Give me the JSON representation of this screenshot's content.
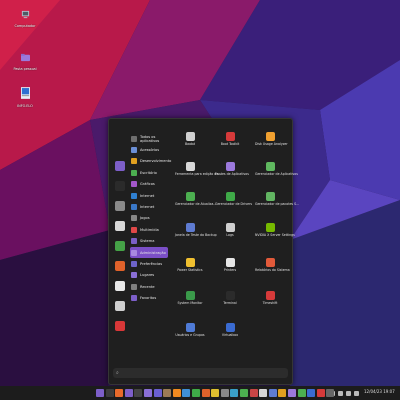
{
  "desktop": {
    "icons": [
      {
        "label": "Computador",
        "icon": "computer-icon"
      },
      {
        "label": "Pasta pessoal",
        "icon": "home-folder-icon"
      },
      {
        "label": "INFO.ELO",
        "icon": "document-icon"
      }
    ]
  },
  "menu": {
    "favorites": [
      {
        "icon": "file-manager-icon",
        "color": "#7d5fc9"
      },
      {
        "icon": "terminal-icon",
        "color": "#2b2b2b"
      },
      {
        "icon": "settings-icon",
        "color": "#8a8a8a"
      },
      {
        "icon": "calendar-icon",
        "color": "#d9d9d9"
      },
      {
        "icon": "green-app-icon",
        "color": "#45a347"
      },
      {
        "icon": "software-icon",
        "color": "#e0622b"
      },
      {
        "icon": "lock-icon",
        "color": "#e8e8e8"
      },
      {
        "icon": "logout-icon",
        "color": "#cfcfcf"
      },
      {
        "icon": "power-icon",
        "color": "#d93838"
      }
    ],
    "categories": [
      {
        "label": "Todos os aplicativos",
        "icon": "grid-icon",
        "color": "#6f6f6f"
      },
      {
        "label": "Acessórios",
        "icon": "accessories-icon",
        "color": "#6b8fd6"
      },
      {
        "label": "Desenvolvimento",
        "icon": "development-icon",
        "color": "#e0a020"
      },
      {
        "label": "Escritório",
        "icon": "office-icon",
        "color": "#4caf50"
      },
      {
        "label": "Gráficos",
        "icon": "graphics-icon",
        "color": "#a357c9"
      },
      {
        "label": "Internet",
        "icon": "internet-icon",
        "color": "#2f80d1"
      },
      {
        "label": "Internet",
        "icon": "internet-icon",
        "color": "#3a78c8"
      },
      {
        "label": "Jogos",
        "icon": "games-icon",
        "color": "#888888"
      },
      {
        "label": "Multimídia",
        "icon": "multimedia-icon",
        "color": "#e04848"
      },
      {
        "label": "Sistema",
        "icon": "system-icon",
        "color": "#7a5fc7"
      },
      {
        "label": "Administração",
        "icon": "administration-icon",
        "color": "#a889e0"
      },
      {
        "label": "Preferências",
        "icon": "preferences-icon",
        "color": "#6e64c9"
      },
      {
        "label": "Lugares",
        "icon": "places-icon",
        "color": "#8a6fd6"
      },
      {
        "label": "Recente",
        "icon": "recent-icon",
        "color": "#7f7f7f"
      },
      {
        "label": "Favoritos",
        "icon": "favorites-icon",
        "color": "#7d5fc9"
      }
    ],
    "selected_category": "Administração",
    "apps": [
      {
        "label": "Baobá",
        "icon": "disk-usage-icon",
        "color": "#d0d0d0"
      },
      {
        "label": "Boot Toolkit",
        "icon": "boot-toolkit-icon",
        "color": "#d63a3a"
      },
      {
        "label": "Disk Usage Analyzer",
        "icon": "disk-usage-analyzer-icon",
        "color": "#f0a030"
      },
      {
        "label": "Ferramenta para edição de...",
        "icon": "editor-tool-icon",
        "color": "#d8d8d8"
      },
      {
        "label": "Fontes de Aplicativos",
        "icon": "sources-icon",
        "color": "#9b79dc"
      },
      {
        "label": "Gerenciador de Aplicativos",
        "icon": "app-manager-icon",
        "color": "#5fb85f"
      },
      {
        "label": "Gerenciador de Atualiza...",
        "icon": "update-manager-icon",
        "color": "#4caf50"
      },
      {
        "label": "Gerenciador de Drivers",
        "icon": "driver-manager-icon",
        "color": "#3faa48"
      },
      {
        "label": "Gerenciador de pacotes S...",
        "icon": "package-manager-icon",
        "color": "#62b562"
      },
      {
        "label": "Janela de Teste da Backup",
        "icon": "backup-icon",
        "color": "#5e7bd1"
      },
      {
        "label": "Logs",
        "icon": "logs-icon",
        "color": "#cfcfcf"
      },
      {
        "label": "NVIDIA X Server Settings",
        "icon": "nvidia-icon",
        "color": "#76b900"
      },
      {
        "label": "Power Statistics",
        "icon": "power-statistics-icon",
        "color": "#f0c030"
      },
      {
        "label": "Printers",
        "icon": "printers-icon",
        "color": "#e6e6e6"
      },
      {
        "label": "Relatórios do Sistema",
        "icon": "system-reports-icon",
        "color": "#e25a3a"
      },
      {
        "label": "System Monitor",
        "icon": "system-monitor-icon",
        "color": "#3a9a4a"
      },
      {
        "label": "Terminal",
        "icon": "terminal-icon",
        "color": "#2b2b2b"
      },
      {
        "label": "Timeshift",
        "icon": "timeshift-icon",
        "color": "#d63a3a"
      },
      {
        "label": "Usuários e Grupos",
        "icon": "users-groups-icon",
        "color": "#4f7bd6"
      },
      {
        "label": "Virtualbox",
        "icon": "virtualbox-icon",
        "color": "#3a6bd1"
      }
    ],
    "search": {
      "icon": "search-icon",
      "value": ""
    }
  },
  "taskbar": {
    "apps": [
      {
        "icon": "menu-icon",
        "color": "#7d5fc9"
      },
      {
        "icon": "show-desktop-icon",
        "color": "#3c3c3c"
      },
      {
        "icon": "firefox-icon",
        "color": "#e86a2b"
      },
      {
        "icon": "files-icon",
        "color": "#7d5fc9"
      },
      {
        "icon": "terminal-icon",
        "color": "#444444"
      },
      {
        "icon": "folder-icon",
        "color": "#8a6fd6"
      },
      {
        "icon": "folder-icon",
        "color": "#6a5fd1"
      },
      {
        "icon": "gimp-icon",
        "color": "#9c7b56"
      },
      {
        "icon": "vlc-icon",
        "color": "#f08a20"
      },
      {
        "icon": "writer-icon",
        "color": "#3f8fd6"
      },
      {
        "icon": "calc-icon",
        "color": "#3faa48"
      },
      {
        "icon": "impress-icon",
        "color": "#e0622b"
      },
      {
        "icon": "chrome-icon",
        "color": "#e0c030"
      },
      {
        "icon": "settings-icon",
        "color": "#888888"
      },
      {
        "icon": "app-icon",
        "color": "#3aa0c8"
      },
      {
        "icon": "app-icon",
        "color": "#4caf50"
      },
      {
        "icon": "app-icon",
        "color": "#c84545"
      },
      {
        "icon": "app-icon",
        "color": "#d6d6d6"
      },
      {
        "icon": "app-icon",
        "color": "#5e7bd1"
      },
      {
        "icon": "app-icon",
        "color": "#e0a020"
      },
      {
        "icon": "app-icon",
        "color": "#9b79dc"
      },
      {
        "icon": "app-icon",
        "color": "#4caf50"
      },
      {
        "icon": "app-icon",
        "color": "#3a6bd1"
      },
      {
        "icon": "app-icon",
        "color": "#d63a3a"
      },
      {
        "icon": "app-icon",
        "color": "#666666"
      }
    ],
    "tray": {
      "clock": "12/04/23 19:07",
      "icons": [
        "network-icon",
        "volume-icon",
        "battery-icon",
        "notifications-icon"
      ]
    }
  },
  "colors": {
    "accent": "#7b4fc7",
    "menu_bg": "#1f1f1f",
    "taskbar_bg": "#1c1c1c"
  }
}
